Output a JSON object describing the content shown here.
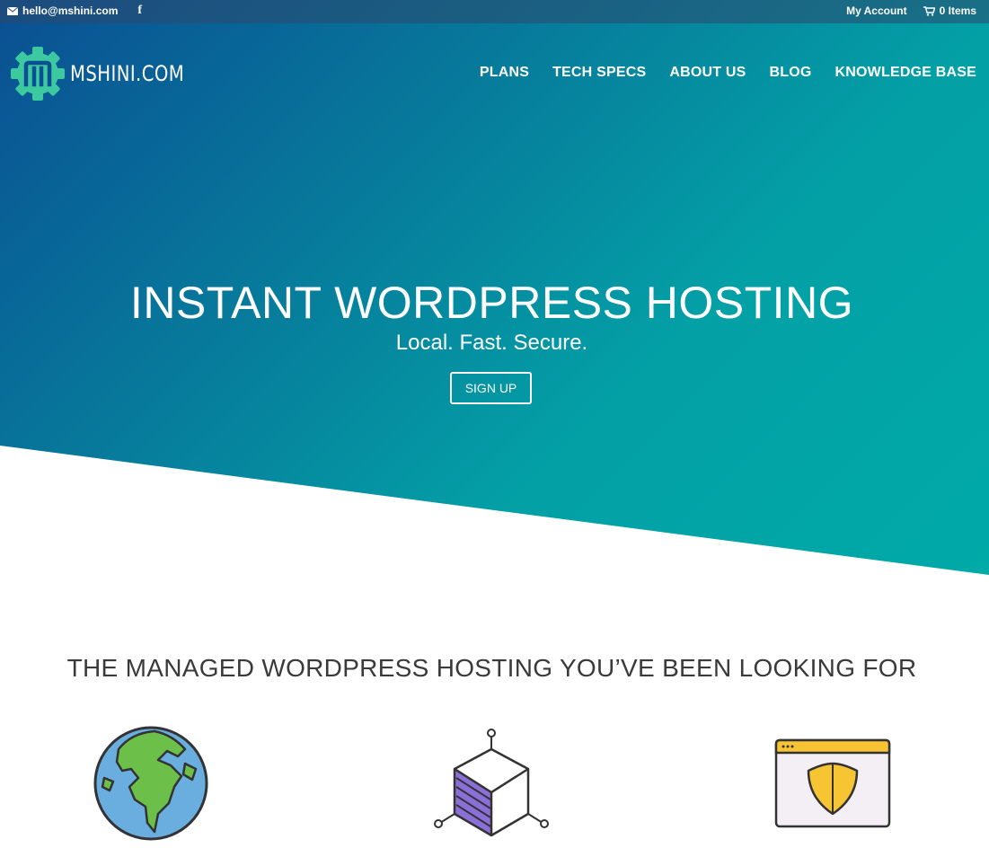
{
  "topbar": {
    "email": "hello@mshini.com",
    "facebook_glyph": "f",
    "account_label": "My Account",
    "cart_label": "0 Items"
  },
  "logo": {
    "text": "MSHINI.COM",
    "icon": "gear-m-icon",
    "color": "#3cc9a0"
  },
  "nav": {
    "items": [
      "PLANS",
      "TECH SPECS",
      "ABOUT US",
      "BLOG",
      "KNOWLEDGE BASE"
    ]
  },
  "hero": {
    "title": "INSTANT WORDPRESS HOSTING",
    "subtitle": "Local. Fast. Secure.",
    "cta_label": "SIGN UP",
    "gradient_start": "#0a4f93",
    "gradient_end": "#00aaa7"
  },
  "features": {
    "title": "THE MANAGED WORDPRESS HOSTING YOU’VE BEEN LOOKING FOR",
    "icons": [
      "globe-icon",
      "hexagon-network-icon",
      "browser-shield-icon"
    ]
  }
}
